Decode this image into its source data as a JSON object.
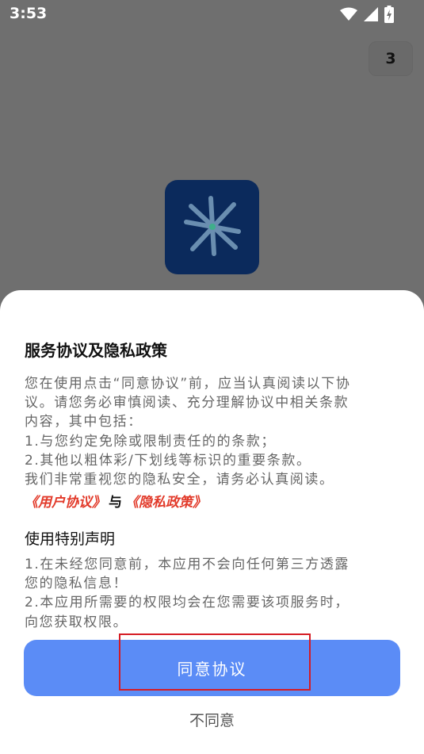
{
  "status_bar": {
    "time": "3:53",
    "icons": [
      "wifi-icon",
      "signal-icon",
      "battery-charging-icon"
    ]
  },
  "countdown": "3",
  "app": {
    "logo_icon": "asterisk-logo-icon",
    "logo_bg": "#0b2a5c"
  },
  "dialog": {
    "title": "服务协议及隐私政策",
    "intro_lines": [
      "您在使用点击“同意协议”前，应当认真阅读以下协",
      "议。请您务必审慎阅读、充分理解协议中相关条款",
      "内容，其中包括：",
      "1.与您约定免除或限制责任的的条款；",
      "2.其他以粗体彩/下划线等标识的重要条款。",
      "我们非常重视您的隐私安全，请务必认真阅读。"
    ],
    "user_agreement_link": "《用户协议》",
    "and_text": "与",
    "privacy_policy_link": "《隐私政策》",
    "special_title": "使用特别声明",
    "special_lines": [
      "1.在未经您同意前，本应用不会向任何第三方透露",
      "您的隐私信息！",
      "2.本应用所需要的权限均会在您需要该项服务时，",
      "向您获取权限。"
    ],
    "agree_button": "同意协议",
    "disagree_button": "不同意"
  },
  "colors": {
    "accent": "#5b8cf6",
    "link": "#e23a2a",
    "highlight": "#d51b24"
  }
}
